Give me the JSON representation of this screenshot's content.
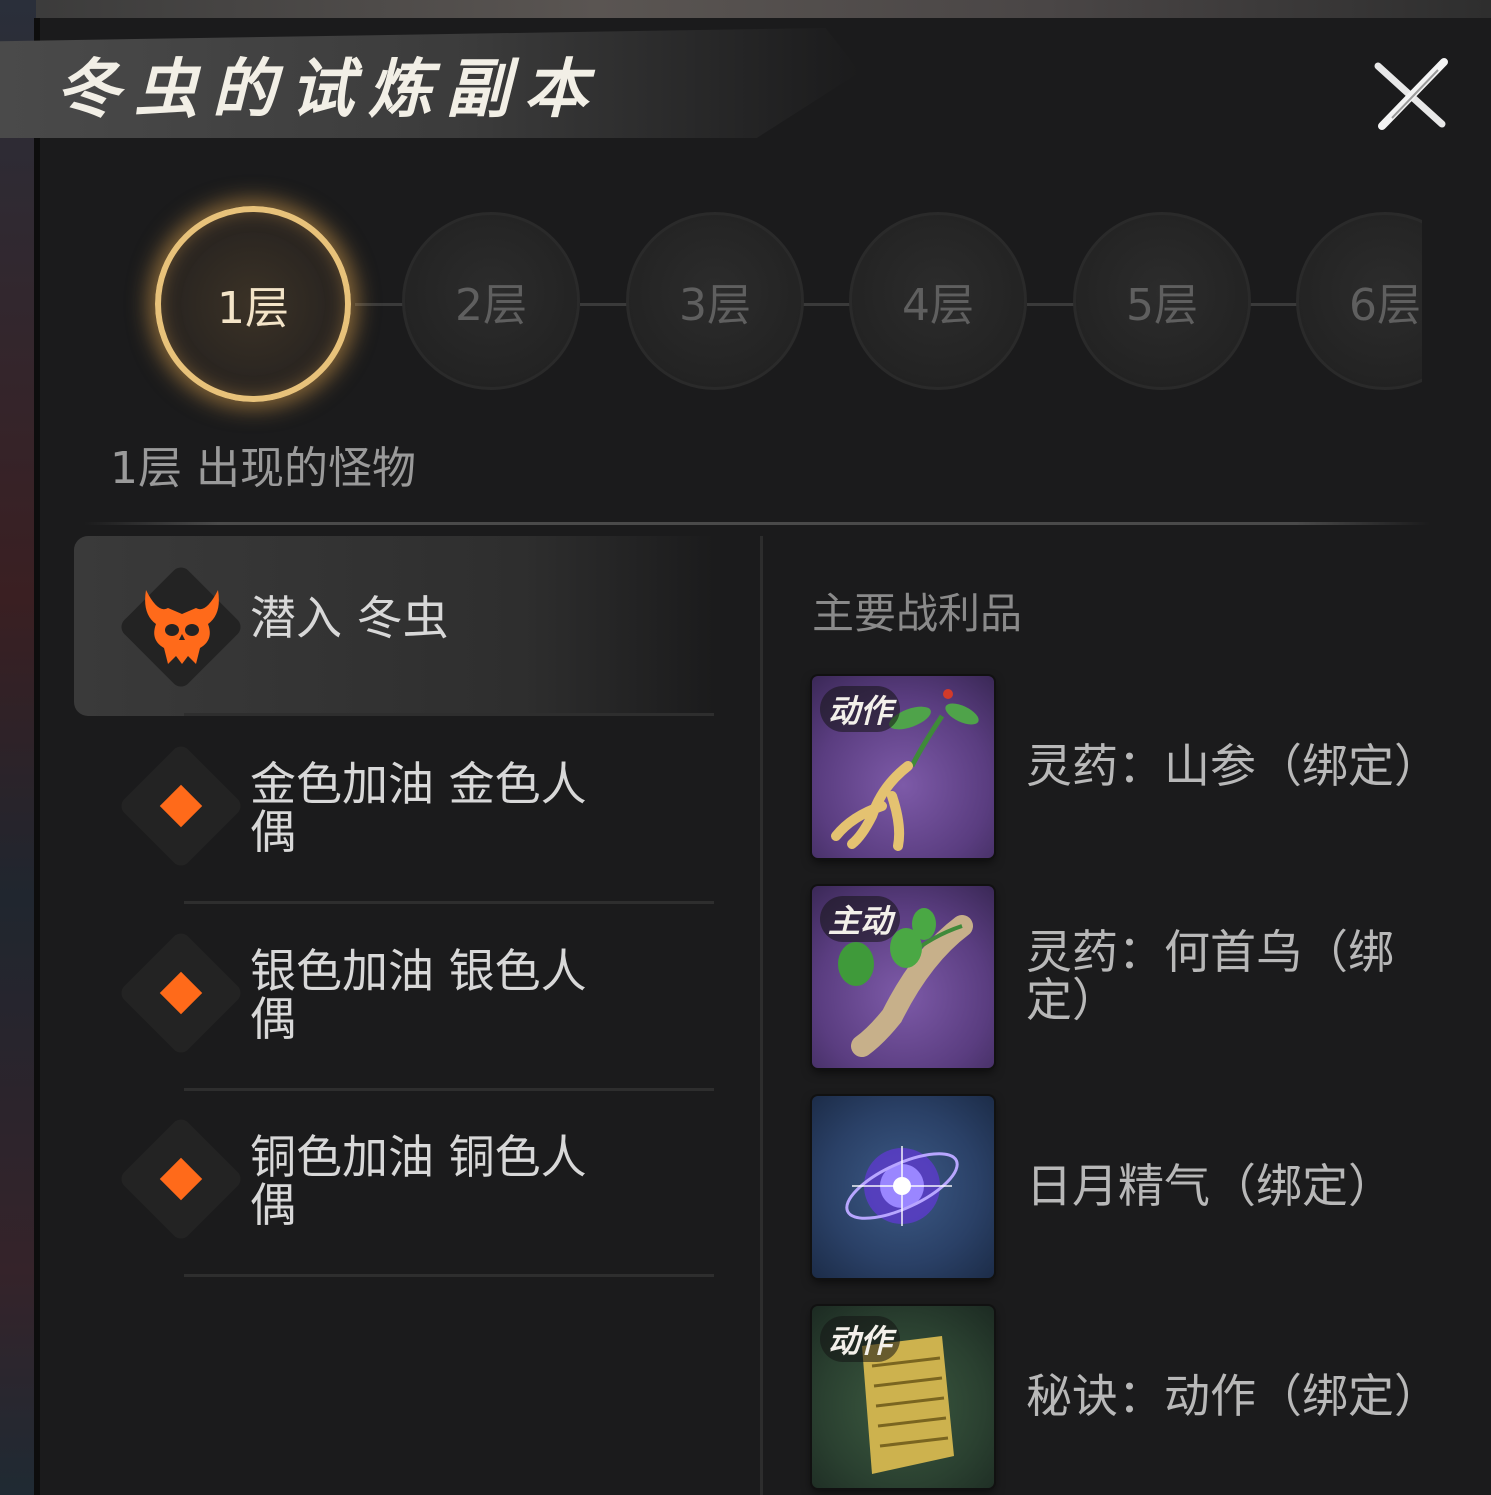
{
  "title": "冬虫的试炼副本",
  "floors": [
    {
      "label": "1层",
      "active": true
    },
    {
      "label": "2层",
      "active": false
    },
    {
      "label": "3层",
      "active": false
    },
    {
      "label": "4层",
      "active": false
    },
    {
      "label": "5层",
      "active": false
    },
    {
      "label": "6层",
      "active": false
    }
  ],
  "section_label": "1层 出现的怪物",
  "monsters": [
    {
      "name": "潜入 冬虫",
      "icon": "boss-skull-icon",
      "selected": true
    },
    {
      "name": "金色加油 金色人偶",
      "icon": "orange-diamond-icon",
      "selected": false
    },
    {
      "name": "银色加油 银色人偶",
      "icon": "orange-diamond-icon",
      "selected": false
    },
    {
      "name": "铜色加油 铜色人偶",
      "icon": "orange-diamond-icon",
      "selected": false
    }
  ],
  "loot": {
    "title": "主要战利品",
    "items": [
      {
        "tag": "动作",
        "name": "灵药：山参（绑定）",
        "icon": "ginseng-icon"
      },
      {
        "tag": "主动",
        "name": "灵药：何首乌（绑定）",
        "icon": "fleeceflower-root-icon"
      },
      {
        "tag": "",
        "name": "日月精气（绑定）",
        "icon": "glowing-orb-icon"
      },
      {
        "tag": "动作",
        "name": "秘诀：动作（绑定）",
        "icon": "scroll-icon"
      }
    ]
  },
  "colors": {
    "accent_orange": "#ff6a1a",
    "active_ring": "#e8c27a"
  }
}
